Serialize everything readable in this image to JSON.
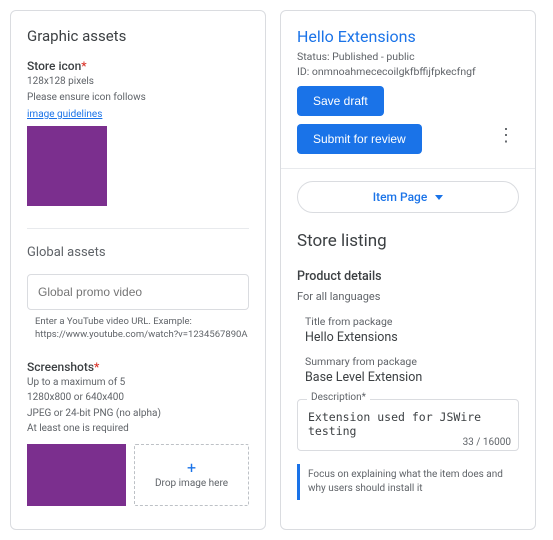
{
  "left": {
    "heading": "Graphic assets",
    "store_icon": {
      "label": "Store icon",
      "req": "*",
      "dims": "128x128 pixels",
      "note": "Please ensure icon follows",
      "link": "image guidelines"
    },
    "global_assets": {
      "label": "Global assets",
      "video_placeholder": "Global promo video",
      "video_hint": "Enter a YouTube video URL. Example: https://www.youtube.com/watch?v=1234567890A"
    },
    "screenshots": {
      "label": "Screenshots",
      "req": "*",
      "line1": "Up to a maximum of 5",
      "line2": "1280x800 or 640x400",
      "line3": "JPEG or 24-bit PNG (no alpha)",
      "line4": "At least one is required",
      "drop": "Drop image here"
    }
  },
  "right": {
    "title": "Hello Extensions",
    "status": "Status: Published - public",
    "id": "ID: onmnoahmececoilgkfbffijfpkecfngf",
    "save_draft": "Save draft",
    "submit": "Submit for review",
    "item_page": "Item Page",
    "section_title": "Store listing",
    "product_details": {
      "heading": "Product details",
      "subheading": "For all languages",
      "title_label": "Title from package",
      "title_value": "Hello Extensions",
      "summary_label": "Summary from package",
      "summary_value": "Base Level Extension",
      "desc_label": "Description*",
      "desc_value": "Extension used for JSWire testing",
      "char_count": "33 / 16000",
      "helper": "Focus on explaining what the item does and why users should install it"
    }
  }
}
